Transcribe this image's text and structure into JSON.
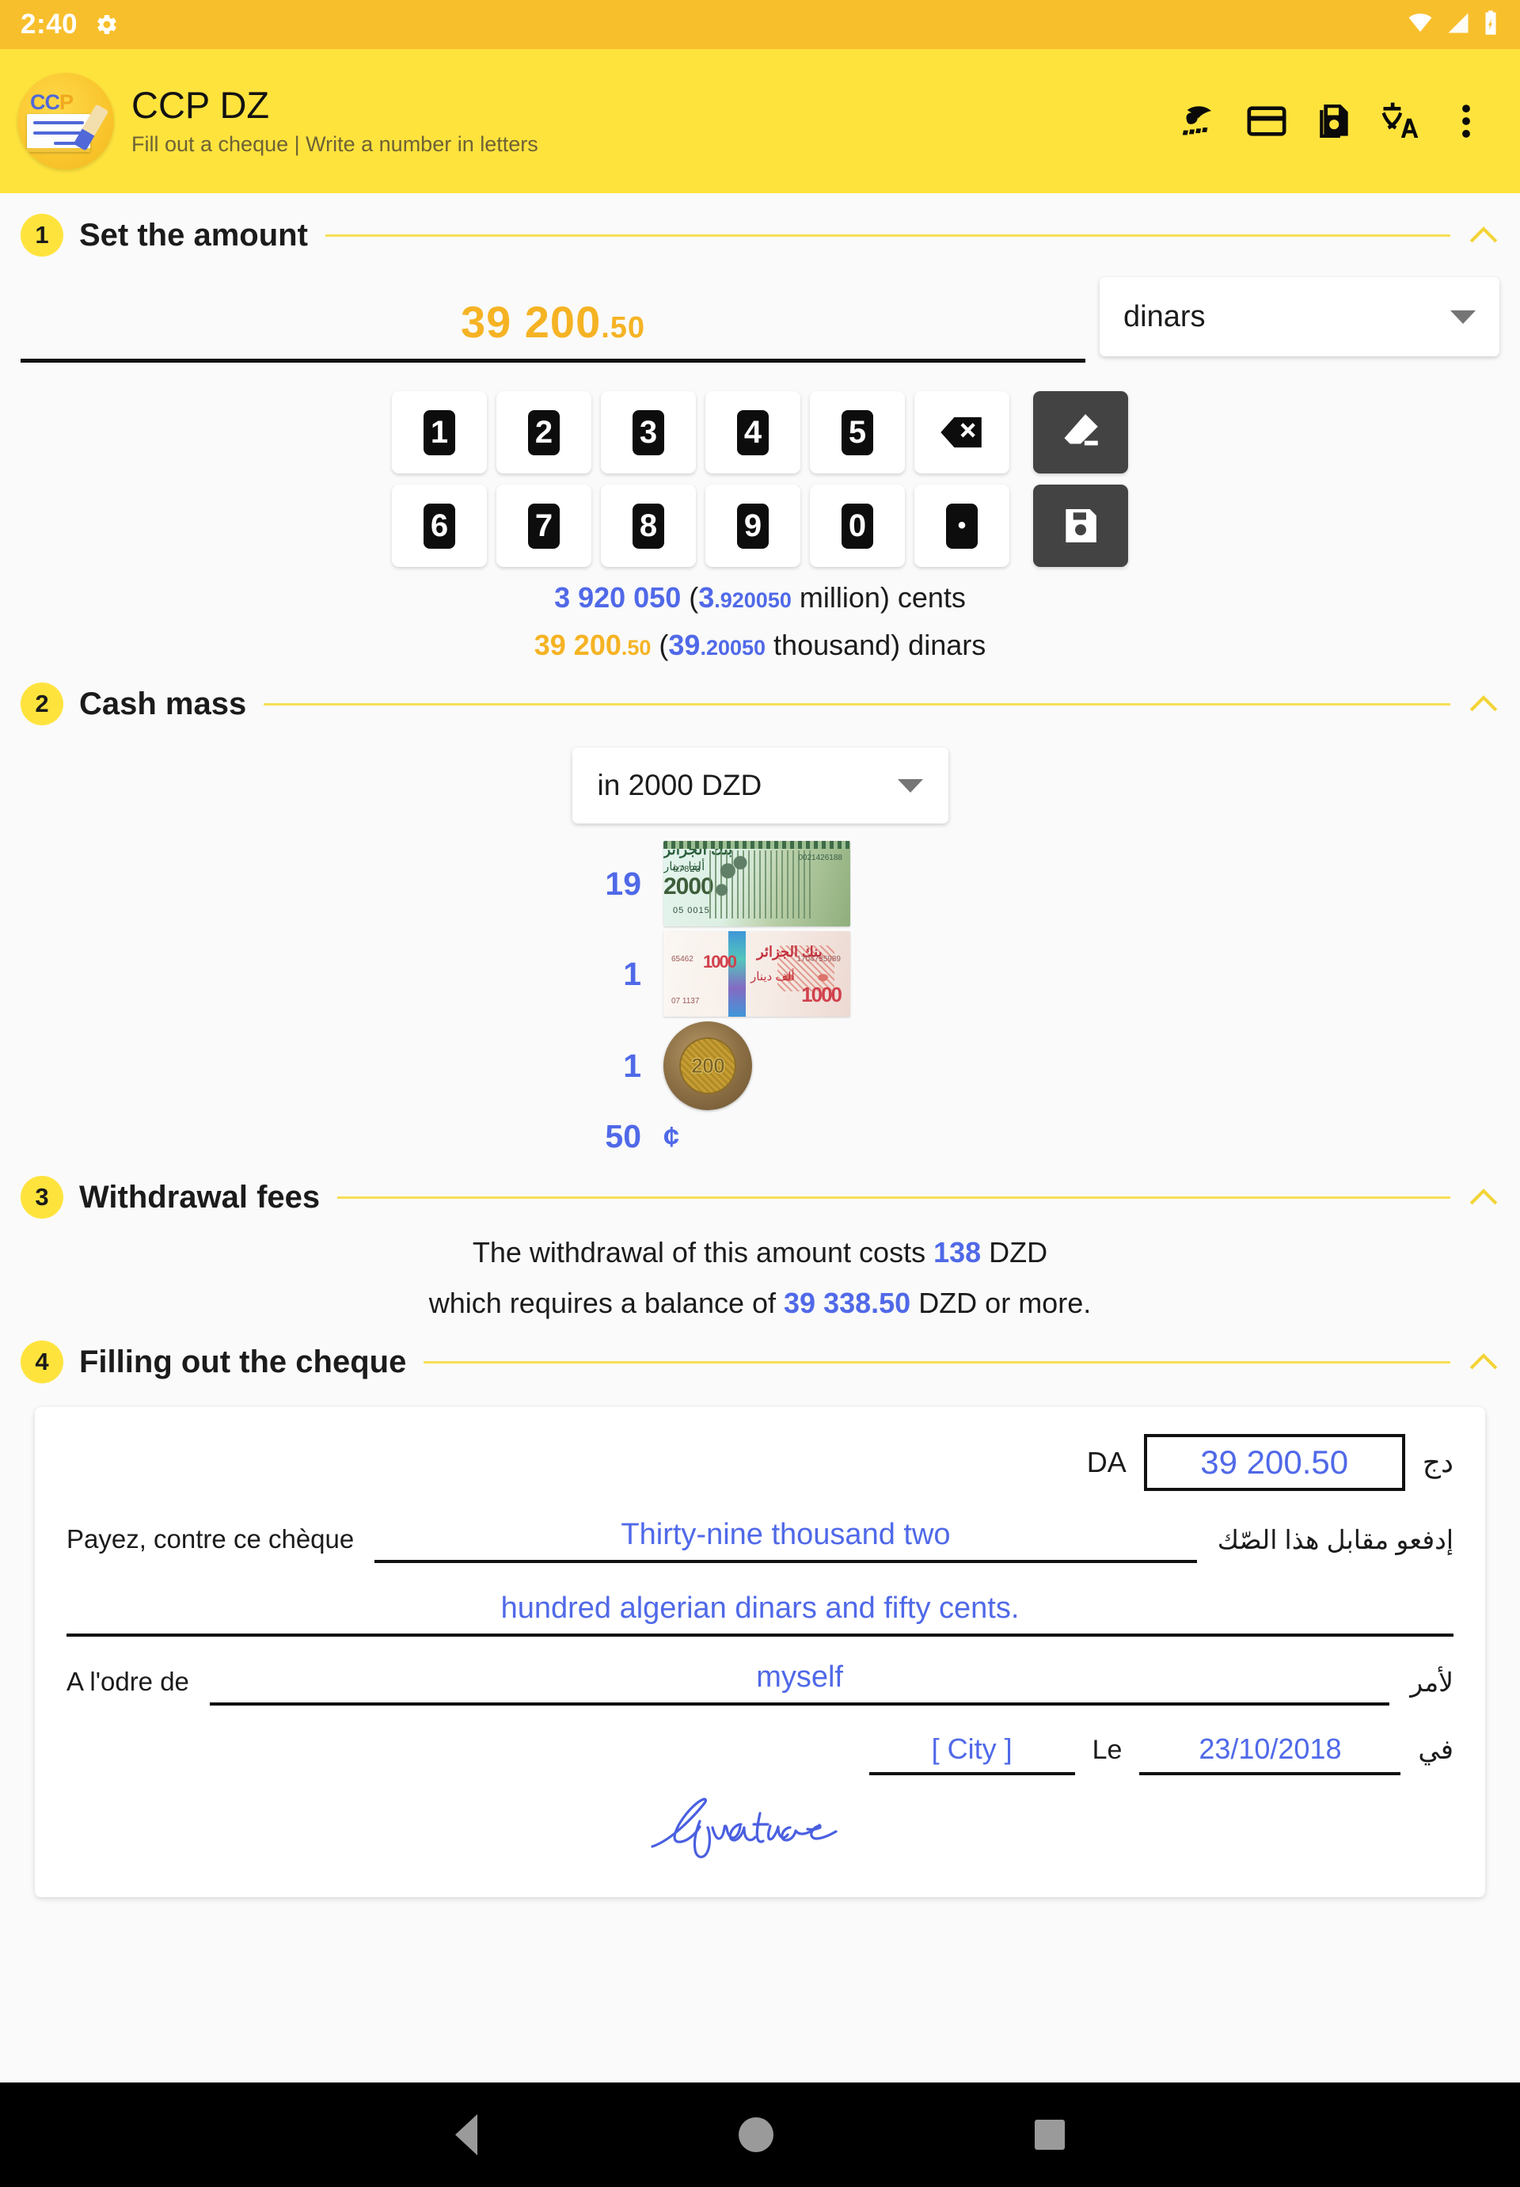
{
  "status_bar": {
    "time": "2:40",
    "icons": [
      "gear-icon",
      "wifi-icon",
      "signal-icon",
      "battery-charging-icon"
    ]
  },
  "app_bar": {
    "logo_text": "CCP",
    "title": "CCP DZ",
    "subtitle": "Fill out a cheque | Write a number in letters",
    "actions": [
      {
        "name": "algeria-post-logo-icon",
        "label": "Algérie Poste"
      },
      {
        "name": "card-icon",
        "label": "Card"
      },
      {
        "name": "save-icon",
        "label": "Save"
      },
      {
        "name": "translate-icon",
        "label": "Translate"
      },
      {
        "name": "overflow-menu-icon",
        "label": "More options"
      }
    ]
  },
  "sections": {
    "amount": {
      "number": "1",
      "title": "Set the amount",
      "value_int": "39 200",
      "value_dec": ".50",
      "currency_selected": "dinars",
      "keypad": {
        "row1": [
          "1",
          "2",
          "3",
          "4",
          "5"
        ],
        "backspace": "⌫",
        "erase": "erase",
        "row2": [
          "6",
          "7",
          "8",
          "9",
          "0"
        ],
        "dot": "•",
        "save": "save"
      },
      "conversion_cents": {
        "main": "3 920 050",
        "paren_int": "3",
        "paren_dec": ".920050",
        "scale": " million) cents",
        "open": " ("
      },
      "conversion_dinars": {
        "main_int": "39 200",
        "main_dec": ".50",
        "paren_int": "39",
        "paren_dec": ".20050",
        "scale": " thousand) dinars",
        "open": " ("
      }
    },
    "cash_mass": {
      "number": "2",
      "title": "Cash mass",
      "denomination_selected": "in 2000 DZD",
      "breakdown": [
        {
          "count": "19",
          "denom": "2000",
          "type": "banknote-2000-dzd",
          "serial_a": "07823",
          "serial_b": "05 0015",
          "serial_c": "0021426188"
        },
        {
          "count": "1",
          "denom": "1000",
          "type": "banknote-1000-dzd",
          "serial_a": "65462",
          "serial_b": "07 1137",
          "serial_c": "1704735989"
        },
        {
          "count": "1",
          "denom": "200",
          "type": "coin-200-dzd",
          "face": "200"
        }
      ],
      "cents": {
        "count": "50",
        "symbol": "¢"
      }
    },
    "fees": {
      "number": "3",
      "title": "Withdrawal fees",
      "line1_pre": "The withdrawal of this amount costs ",
      "line1_value": "138",
      "line1_post": " DZD",
      "line2_pre": "which requires a balance of ",
      "line2_value": "39 338.50",
      "line2_post": " DZD or more."
    },
    "cheque": {
      "number": "4",
      "title": "Filling out the cheque",
      "currency_left": "DA",
      "amount_boxed": "39 200.50",
      "currency_right": "دج",
      "pay_label_fr": "Payez, contre ce chèque",
      "pay_label_ar": "إدفعو مقابل هذا الصّك",
      "words_line1": "Thirty-nine thousand two",
      "words_line2": "hundred algerian dinars and fifty cents.",
      "order_label_fr": "A l'odre de",
      "order_label_ar": "لأمر",
      "order_value": "myself",
      "city_value": "[ City ]",
      "le_label": "Le",
      "date_value": "23/10/2018",
      "date_label_ar": "في",
      "signature_text": "Signature"
    }
  },
  "nav_bar": {
    "items": [
      {
        "name": "nav-back-button",
        "label": "Back"
      },
      {
        "name": "nav-home-button",
        "label": "Home"
      },
      {
        "name": "nav-recents-button",
        "label": "Recents"
      }
    ]
  },
  "colors": {
    "status_bar": "#f8bf2c",
    "app_bar": "#ffe33d",
    "accent_gold": "#f5b324",
    "accent_blue": "#5069e8",
    "rule": "#f7df55"
  }
}
